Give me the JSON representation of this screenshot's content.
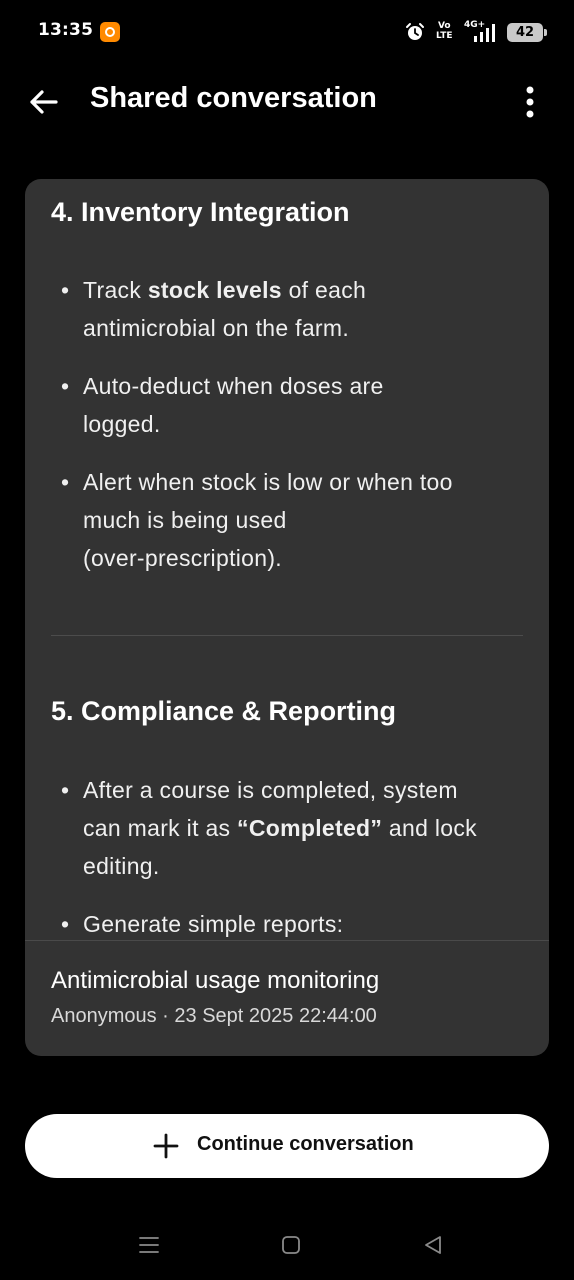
{
  "status_bar": {
    "time": "13:35",
    "network_top": "Vo",
    "network_bottom": "LTE",
    "network_gen": "4G+",
    "battery": "42",
    "icons": [
      "app-notification-icon",
      "alarm-icon",
      "volte-icon",
      "signal-icon",
      "battery-icon"
    ]
  },
  "app_bar": {
    "title": "Shared conversation",
    "back_icon": "arrow-left-icon",
    "menu_icon": "more-vertical-icon"
  },
  "card": {
    "section4": {
      "heading": "4. Inventory Integration",
      "bullets": [
        {
          "pre": "Track ",
          "bold": "stock levels",
          "post": " of each\nantimicrobial on the farm."
        },
        {
          "text": "Auto-deduct when doses are\nlogged."
        },
        {
          "text": "Alert when stock is low or when too\nmuch is being used\n(over-prescription)."
        }
      ]
    },
    "section5": {
      "heading": "5. Compliance & Reporting",
      "bullets": [
        {
          "pre": "After a course is completed, system\ncan mark it as ",
          "bold": "“Completed”",
          "post": " and lock\nediting."
        },
        {
          "text": "Generate simple reports:"
        }
      ]
    },
    "footer": {
      "conversation_title": "Antimicrobial usage monitoring",
      "author": "Anonymous",
      "separator": " · ",
      "datetime": "23 Sept 2025 22:44:00"
    }
  },
  "continue_button": {
    "label": "Continue conversation",
    "icon": "plus-icon"
  },
  "nav_bar": {
    "icons": [
      "recent-apps-icon",
      "home-icon",
      "back-triangle-icon"
    ]
  },
  "colors": {
    "background": "#000000",
    "card": "#333333",
    "button": "#ffffff",
    "battery": "#c9c9c9",
    "notification_icon": "#ff8a00"
  }
}
